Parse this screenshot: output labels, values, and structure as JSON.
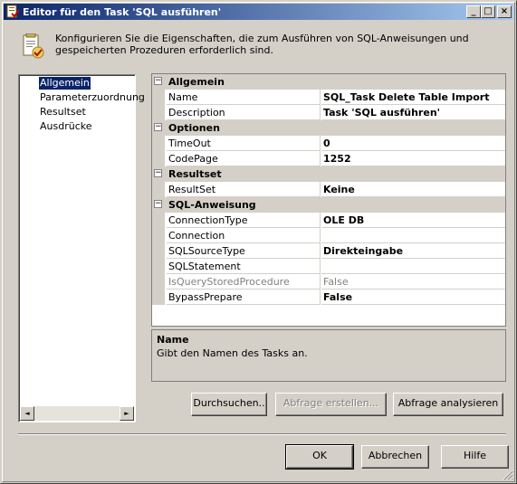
{
  "window": {
    "title": "Editor für den Task 'SQL ausführen'",
    "minimize_glyph": "_",
    "maximize_glyph": "□",
    "close_glyph": "×"
  },
  "header": {
    "icon": "sql-task-icon",
    "description": "Konfigurieren Sie die Eigenschaften, die zum Ausführen von SQL-Anweisungen und gespeicherten Prozeduren erforderlich sind."
  },
  "nav": {
    "items": [
      {
        "label": "Allgemein",
        "selected": true
      },
      {
        "label": "Parameterzuordnung",
        "selected": false
      },
      {
        "label": "Resultset",
        "selected": false
      },
      {
        "label": "Ausdrücke",
        "selected": false
      }
    ],
    "scroll_left": "◄",
    "scroll_right": "►"
  },
  "grid": {
    "categories": [
      {
        "label": "Allgemein",
        "toggle": "−",
        "rows": [
          {
            "name": "Name",
            "value": "SQL_Task Delete Table Import"
          },
          {
            "name": "Description",
            "value": "Task 'SQL ausführen'"
          }
        ]
      },
      {
        "label": "Optionen",
        "toggle": "−",
        "rows": [
          {
            "name": "TimeOut",
            "value": "0"
          },
          {
            "name": "CodePage",
            "value": "1252"
          }
        ]
      },
      {
        "label": "Resultset",
        "toggle": "−",
        "rows": [
          {
            "name": "ResultSet",
            "value": "Keine"
          }
        ]
      },
      {
        "label": "SQL-Anweisung",
        "toggle": "−",
        "rows": [
          {
            "name": "ConnectionType",
            "value": "OLE DB"
          },
          {
            "name": "Connection",
            "value": ""
          },
          {
            "name": "SQLSourceType",
            "value": "Direkteingabe"
          },
          {
            "name": "SQLStatement",
            "value": ""
          },
          {
            "name": "IsQueryStoredProcedure",
            "value": "False",
            "disabled": true
          },
          {
            "name": "BypassPrepare",
            "value": "False"
          }
        ]
      }
    ]
  },
  "description_panel": {
    "title": "Name",
    "text": "Gibt den Namen des Tasks an."
  },
  "actions": {
    "browse": "Durchsuchen..",
    "build_query": "Abfrage erstellen...",
    "parse_query": "Abfrage analysieren"
  },
  "footer": {
    "ok": "OK",
    "cancel": "Abbrechen",
    "help": "Hilfe"
  }
}
